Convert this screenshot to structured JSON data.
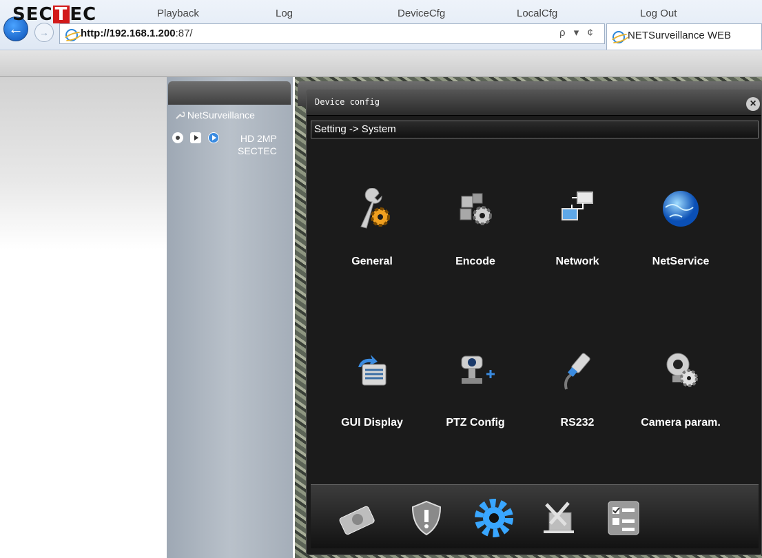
{
  "browser": {
    "url_host": "http://192.168.1.200",
    "url_rest": ":87/",
    "tab_title": "NETSurveillance WEB",
    "address_tools": "ρ ▾ ¢"
  },
  "brand": {
    "logo_part1": "SEC",
    "logo_part2": "T",
    "logo_part3": "EC"
  },
  "nav": {
    "playback": "Playback",
    "log": "Log",
    "devicecfg": "DeviceCfg",
    "localcfg": "LocalCfg",
    "logout": "Log Out"
  },
  "device_tree": {
    "root": "NetSurveillance",
    "camera_line1": "HD 2MP",
    "camera_line2": "SECTEC"
  },
  "dialog": {
    "title": "Device config",
    "breadcrumb": "Setting -> System",
    "items": [
      {
        "label": "General",
        "icon": "wrench-gear-icon"
      },
      {
        "label": "Encode",
        "icon": "puzzle-gear-icon"
      },
      {
        "label": "Network",
        "icon": "network-icon"
      },
      {
        "label": "NetService",
        "icon": "globe-icon"
      },
      {
        "label": "GUI Display",
        "icon": "gui-display-icon"
      },
      {
        "label": "PTZ Config",
        "icon": "ptz-camera-icon"
      },
      {
        "label": "RS232",
        "icon": "rs232-cable-icon"
      },
      {
        "label": "Camera param.",
        "icon": "camera-param-icon"
      }
    ],
    "bottom_tabs": [
      {
        "icon": "storage-disk-icon"
      },
      {
        "icon": "alarm-shield-icon"
      },
      {
        "icon": "system-gear-icon"
      },
      {
        "icon": "tools-icon"
      },
      {
        "icon": "checklist-icon"
      }
    ]
  },
  "colors": {
    "accent_blue": "#2b86d9",
    "brand_red": "#d21a1a"
  }
}
